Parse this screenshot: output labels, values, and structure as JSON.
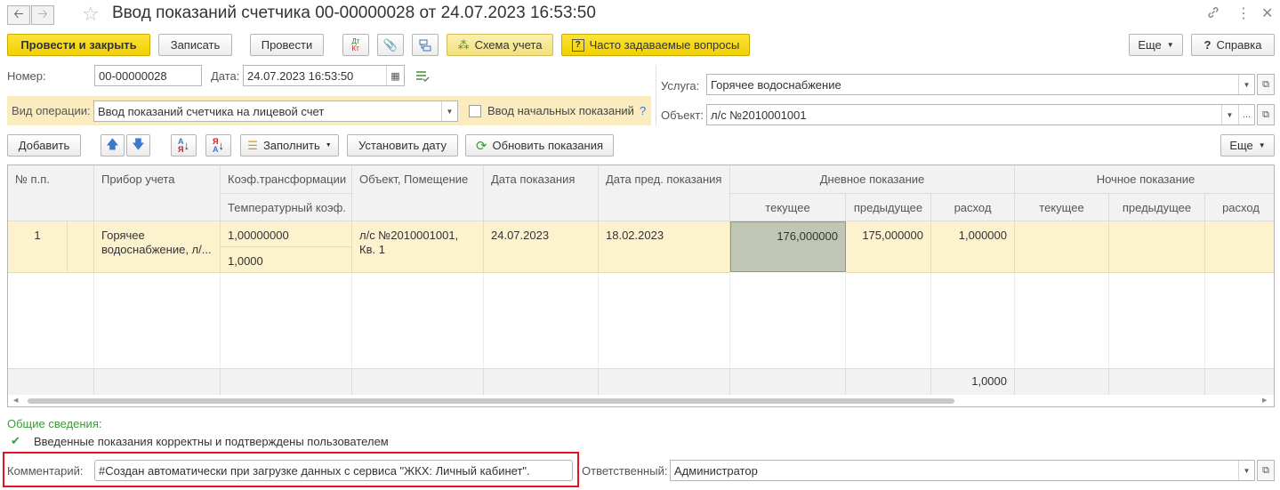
{
  "window": {
    "title": "Ввод показаний счетчика 00-00000028 от 24.07.2023 16:53:50",
    "icons": [
      "arrow-left-icon",
      "arrow-right-icon",
      "star-icon",
      "link-icon",
      "more-vertical-icon",
      "close-icon"
    ]
  },
  "toolbar": {
    "post_and_close": "Провести и закрыть",
    "save": "Записать",
    "post": "Провести",
    "dt_kt_top": "Дт",
    "dt_kt_bottom": "Кт",
    "accounting_scheme": "Схема учета",
    "faq_mark": "?",
    "faq": "Часто задаваемые вопросы",
    "more": "Еще",
    "help_mark": "?",
    "help": "Справка"
  },
  "header": {
    "number_label": "Номер:",
    "number_value": "00-00000028",
    "date_label": "Дата:",
    "date_value": "24.07.2023 16:53:50",
    "operation_label": "Вид операции:",
    "operation_value": "Ввод показаний счетчика на лицевой счет",
    "initial_readings_label": "Ввод начальных показаний",
    "initial_readings_checked": false,
    "initial_readings_help": "?",
    "service_label": "Услуга:",
    "service_value": "Горячее водоснабжение",
    "object_label": "Объект:",
    "object_value": "л/с №2010001001",
    "ellipsis": "..."
  },
  "table_toolbar": {
    "add": "Добавить",
    "fill": "Заполнить",
    "set_date": "Установить дату",
    "refresh": "Обновить показания",
    "more": "Еще"
  },
  "table": {
    "headers": {
      "num": "№ п.п.",
      "device": "Прибор учета",
      "coef": "Коэф.трансформации",
      "temp_coef": "Температурный коэф.",
      "object": "Объект, Помещение",
      "reading_date": "Дата показания",
      "prev_date": "Дата пред. показания",
      "day": "Дневное показание",
      "night": "Ночное показание",
      "current": "текущее",
      "previous": "предыдущее",
      "consumption": "расход"
    },
    "rows": [
      {
        "num": "1",
        "device": "Горячее водоснабжение, л/...",
        "coef": "1,00000000",
        "temp_coef": "1,0000",
        "object": "л/с №2010001001, Кв. 1",
        "reading_date": "24.07.2023",
        "prev_date": "18.02.2023",
        "day_current": "176,000000",
        "day_previous": "175,000000",
        "day_consumption": "1,000000",
        "night_current": "",
        "night_previous": "",
        "night_consumption": ""
      }
    ],
    "footer": {
      "day_consumption_total": "1,0000"
    }
  },
  "footer": {
    "general_info_label": "Общие сведения:",
    "confirmation": "Введенные показания корректны и подтверждены пользователем",
    "comment_label": "Комментарий:",
    "comment_value": "#Создан автоматически при загрузке данных с сервиса \"ЖКХ: Личный кабинет\".",
    "responsible_label": "Ответственный:",
    "responsible_value": "Администратор"
  },
  "colors": {
    "accent_yellow": "#f3d000",
    "row_highlight": "#fcf2cd",
    "operation_strip": "#fbecc0",
    "selected_cell": "#bfc6b3",
    "highlight_frame": "#e0141e",
    "green_text": "#3a9b3a"
  }
}
